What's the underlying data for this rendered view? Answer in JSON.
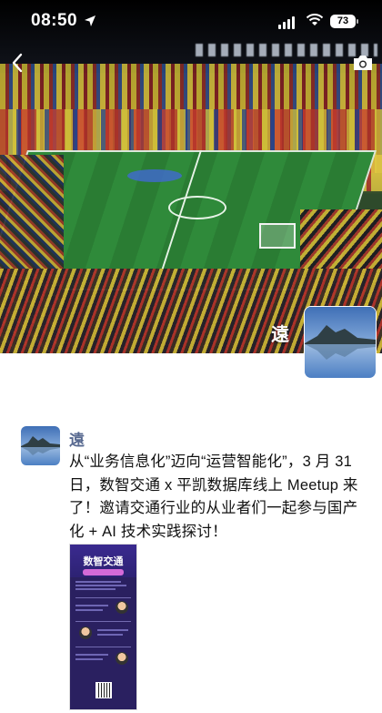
{
  "status_bar": {
    "time": "08:50",
    "battery": "73"
  },
  "cover": {
    "user_name": "遠"
  },
  "post": {
    "author": "遠",
    "text": "从“业务信息化”迈向“运营智能化”，3 月 31 日，数智交通 x 平凯数据库线上 Meetup 来了！邀请交通行业的从业者们一起参与国产化 + AI 技术实践探讨！",
    "poster_title": "数智交通"
  },
  "colors": {
    "link_name": "#56688f",
    "poster_bg": "#2a2060"
  },
  "icons": [
    "back-arrow-icon",
    "camera-icon",
    "location-arrow-icon",
    "signal-icon",
    "wifi-icon",
    "battery-icon"
  ]
}
